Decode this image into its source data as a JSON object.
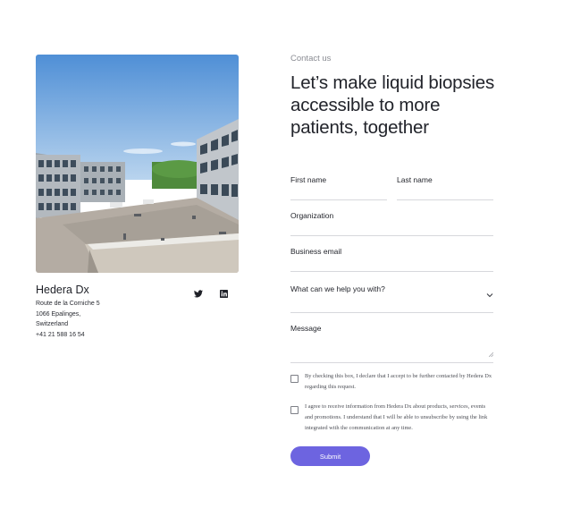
{
  "left": {
    "company": "Hedera Dx",
    "address": [
      "Route de la Corniche 5",
      "1066 Epalinges,",
      "Switzerland",
      "+41 21 588 16 54"
    ],
    "social": {
      "twitter_icon": "twitter-icon",
      "linkedin_icon": "linkedin-icon"
    }
  },
  "contact": {
    "eyebrow": "Contact us",
    "headline": "Let’s make liquid biopsies accessible to more patients, together"
  },
  "form": {
    "first_name_label": "First name",
    "last_name_label": "Last name",
    "organization_label": "Organization",
    "email_label": "Business email",
    "help_select_value": "What can we help you with?",
    "message_label": "Message",
    "consent_text": "By checking this box, I declare that I accept to be further contacted by Hedera Dx regarding this request.",
    "marketing_text": "I agree to receive information from Hedera Dx about products, services, events and promotions. I understand that I will be able to unsubscribe by using the link integrated with the communication at any time.",
    "submit_label": "Submit"
  },
  "colors": {
    "accent": "#6d64e0",
    "text": "#1f2128",
    "muted": "#8a8c93",
    "divider": "#d7d8dc"
  }
}
